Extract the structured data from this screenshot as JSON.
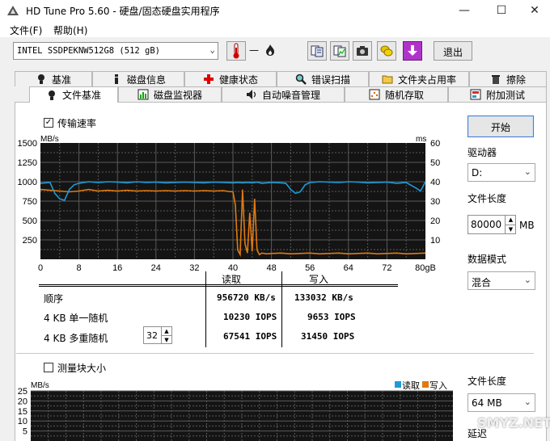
{
  "window": {
    "title": "HD Tune Pro 5.60 - 硬盘/固态硬盘实用程序",
    "minimize_glyph": "—",
    "maximize_glyph": "☐",
    "close_glyph": "✕"
  },
  "menu": {
    "file": "文件(F)",
    "help": "帮助(H)"
  },
  "toolbar": {
    "drive": "INTEL SSDPEKNW512G8 (512 gB)",
    "temperature": "—",
    "exit_label": "退出",
    "icons": [
      "thermometer-icon",
      "copy-info-icon",
      "copy-chart-icon",
      "camera-icon",
      "coins-icon",
      "download-icon"
    ]
  },
  "tabs_top": [
    {
      "label": "基准",
      "icon": "lightbulb-icon"
    },
    {
      "label": "磁盘信息",
      "icon": "info-icon"
    },
    {
      "label": "健康状态",
      "icon": "plus-icon"
    },
    {
      "label": "错误扫描",
      "icon": "magnifier-icon"
    },
    {
      "label": "文件夹占用率",
      "icon": "folder-icon"
    },
    {
      "label": "擦除",
      "icon": "trash-icon"
    }
  ],
  "tabs_bottom": [
    {
      "label": "文件基准",
      "icon": "lightbulb-icon",
      "active": true
    },
    {
      "label": "磁盘监视器",
      "icon": "monitor-icon"
    },
    {
      "label": "自动噪音管理",
      "icon": "speaker-icon"
    },
    {
      "label": "随机存取",
      "icon": "random-icon"
    },
    {
      "label": "附加测试",
      "icon": "extra-icon"
    }
  ],
  "benchmark": {
    "transfer_rate_label": "传输速率",
    "transfer_rate_checked": true,
    "block_size_label": "测量块大小",
    "block_size_checked": false
  },
  "stats": {
    "read_header": "读取",
    "write_header": "写入",
    "rows": [
      {
        "label": "顺序",
        "read": "956720 KB/s",
        "write": "133032 KB/s"
      },
      {
        "label": "4 KB 单一随机",
        "read": "10230 IOPS",
        "write": "9653 IOPS"
      },
      {
        "label": "4 KB 多重随机",
        "read": "67541 IOPS",
        "write": "31450 IOPS"
      }
    ],
    "queue_depth": "32"
  },
  "controls": {
    "start_label": "开始",
    "drive_label": "驱动器",
    "drive_value": "D:",
    "file_length_label": "文件长度",
    "file_length_value": "80000",
    "file_length_unit": "MB",
    "data_mode_label": "数据模式",
    "data_mode_value": "混合",
    "file_length2_label": "文件长度",
    "file_length2_value": "64 MB",
    "delay_label": "延迟"
  },
  "watermark": "SMYZ.NET",
  "colors": {
    "read": "#1e9bd7",
    "write": "#e07a10",
    "chart_bg": "#141414",
    "grid": "#5a5a5a"
  },
  "chart_data": [
    {
      "type": "line",
      "title": "",
      "ylabel_left": "MB/s",
      "ylabel_right": "ms",
      "ylim": [
        0,
        1500
      ],
      "ylim_right": [
        0,
        60
      ],
      "y_ticks": [
        "1500",
        "1250",
        "1000",
        "750",
        "500",
        "250"
      ],
      "y_ticks_right": [
        "60",
        "50",
        "40",
        "30",
        "20",
        "10"
      ],
      "x_ticks": [
        "0",
        "8",
        "16",
        "24",
        "32",
        "40",
        "48",
        "56",
        "64",
        "72",
        "80gB"
      ],
      "xlim": [
        0,
        80
      ],
      "grid": true,
      "series": [
        {
          "name": "读取",
          "color": "#1e9bd7",
          "x": [
            0,
            1,
            2,
            3,
            4,
            5,
            6,
            7,
            8,
            10,
            12,
            14,
            16,
            18,
            20,
            22,
            24,
            26,
            28,
            30,
            32,
            34,
            36,
            38,
            40,
            41,
            42,
            43,
            44,
            45,
            46,
            48,
            50,
            51,
            52,
            53,
            54,
            55,
            56,
            58,
            60,
            62,
            64,
            66,
            68,
            70,
            72,
            74,
            76,
            78,
            79,
            80
          ],
          "y": [
            980,
            985,
            990,
            850,
            780,
            760,
            900,
            960,
            980,
            1000,
            990,
            1000,
            995,
            985,
            1000,
            990,
            995,
            985,
            990,
            995,
            990,
            985,
            995,
            990,
            985,
            990,
            985,
            990,
            985,
            995,
            980,
            990,
            985,
            980,
            900,
            850,
            870,
            960,
            990,
            1000,
            995,
            990,
            1000,
            995,
            985,
            990,
            995,
            980,
            990,
            920,
            880,
            1000
          ]
        },
        {
          "name": "写入",
          "color": "#e07a10",
          "x": [
            0,
            2,
            4,
            6,
            8,
            10,
            12,
            14,
            16,
            18,
            20,
            22,
            24,
            26,
            28,
            30,
            32,
            34,
            36,
            38,
            39,
            40,
            40.5,
            41,
            41.5,
            42,
            42.5,
            43,
            43.5,
            44,
            44.5,
            45,
            45.5,
            46,
            47,
            48,
            50,
            52,
            54,
            56,
            58,
            60,
            62,
            64,
            66,
            68,
            70,
            72,
            74,
            76,
            78,
            80
          ],
          "y": [
            900,
            890,
            880,
            870,
            880,
            900,
            880,
            890,
            880,
            890,
            880,
            885,
            880,
            885,
            880,
            885,
            880,
            885,
            880,
            885,
            875,
            870,
            700,
            120,
            60,
            900,
            200,
            80,
            600,
            100,
            780,
            120,
            60,
            80,
            70,
            75,
            80,
            70,
            75,
            80,
            70,
            75,
            80,
            70,
            75,
            80,
            70,
            75,
            80,
            70,
            75,
            80
          ]
        }
      ]
    },
    {
      "type": "bar",
      "title": "",
      "ylabel_left": "MB/s",
      "ylim": [
        0,
        25
      ],
      "y_ticks": [
        "25",
        "20",
        "15",
        "10",
        "5"
      ],
      "legend": [
        "读取",
        "写入"
      ],
      "legend_position": "top-right",
      "grid": true,
      "series": []
    }
  ]
}
